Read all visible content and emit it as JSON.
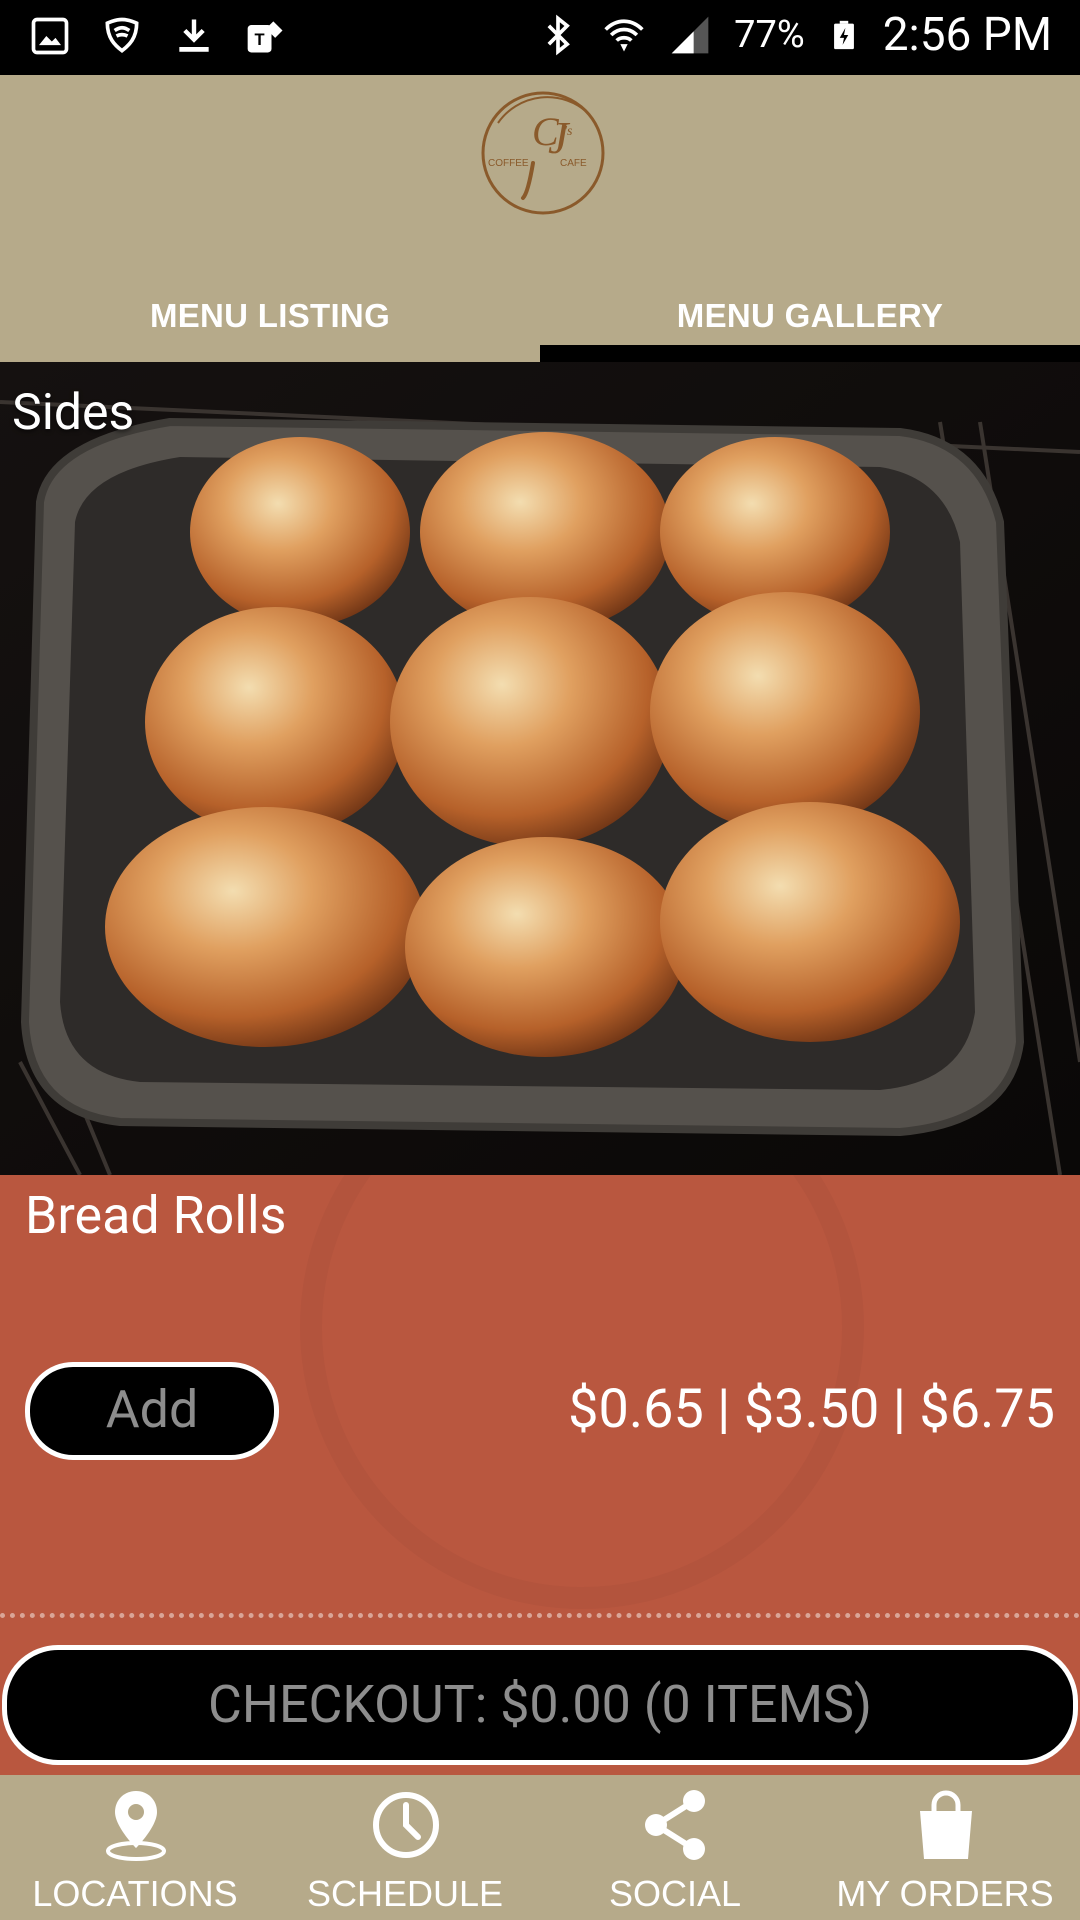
{
  "status_bar": {
    "battery": "77%",
    "time": "2:56 PM",
    "icons": [
      "gallery-icon",
      "shield-icon",
      "download-icon",
      "tmobile-icon",
      "bluetooth-icon",
      "wifi-icon",
      "signal-icon",
      "battery-icon"
    ]
  },
  "header": {
    "logo_text": "CJ's",
    "tabs": [
      {
        "label": "MENU LISTING",
        "active": false
      },
      {
        "label": "MENU GALLERY",
        "active": true
      }
    ]
  },
  "gallery": {
    "category": "Sides",
    "item": {
      "name": "Bread Rolls",
      "add_label": "Add",
      "prices": "$0.65 | $3.50 | $6.75"
    }
  },
  "checkout": {
    "label": "CHECKOUT: $0.00 (0 ITEMS)"
  },
  "bottom_nav": [
    {
      "label": "LOCATIONS",
      "icon": "location-pin-icon"
    },
    {
      "label": "SCHEDULE",
      "icon": "clock-icon"
    },
    {
      "label": "SOCIAL",
      "icon": "share-icon"
    },
    {
      "label": "MY ORDERS",
      "icon": "shopping-bag-icon"
    }
  ],
  "colors": {
    "header_bg": "#b6aa8a",
    "panel_bg": "#b9573f",
    "button_bg": "#000000",
    "button_text": "#8d8d8d"
  }
}
